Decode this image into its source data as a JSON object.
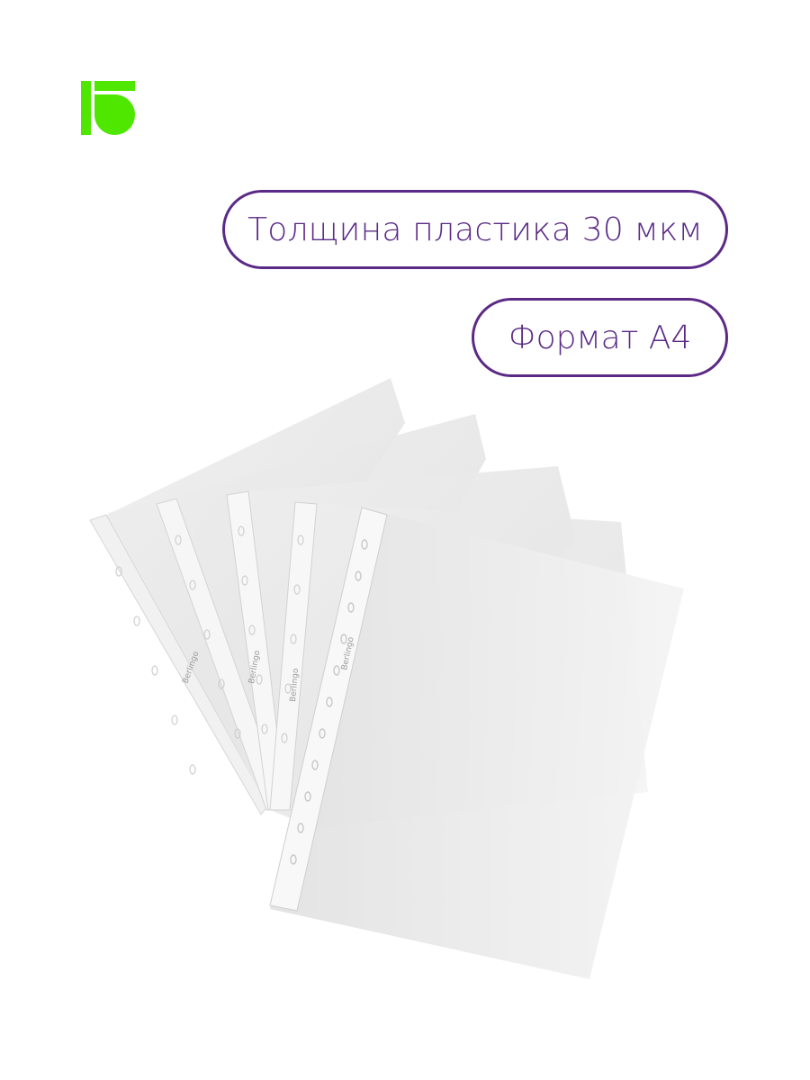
{
  "brand": {
    "logo_icon": "berlingo-logo-icon",
    "logo_color": "#4fe600"
  },
  "badges": {
    "thickness": "Толщина пластика 30 мкм",
    "format": "Формат А4",
    "border_color": "#5b2a86"
  },
  "product": {
    "sheets_count": 5,
    "strip_brand_text": "Berlingo",
    "icon": "punched-sheet-protectors-icon"
  }
}
